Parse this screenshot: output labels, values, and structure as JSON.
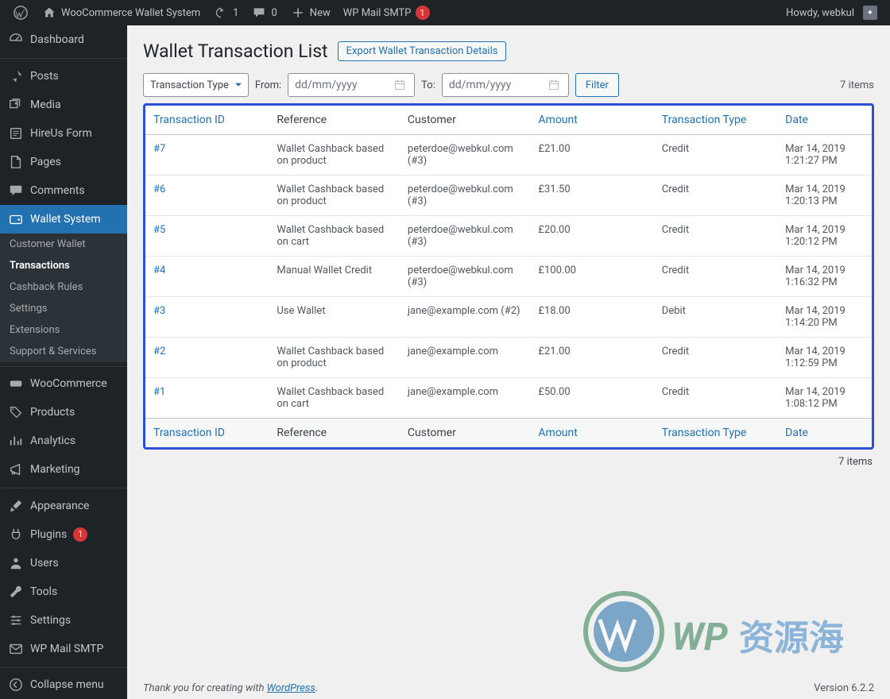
{
  "toolbar": {
    "site_name": "WooCommerce Wallet System",
    "updates": "1",
    "comments": "0",
    "new": "New",
    "smtp": "WP Mail SMTP",
    "smtp_badge": "1",
    "howdy": "Howdy, webkul"
  },
  "sidebar": {
    "items": [
      {
        "label": "Dashboard"
      },
      {
        "label": "Posts"
      },
      {
        "label": "Media"
      },
      {
        "label": "HireUs Form"
      },
      {
        "label": "Pages"
      },
      {
        "label": "Comments"
      },
      {
        "label": "Wallet System"
      },
      {
        "label": "WooCommerce"
      },
      {
        "label": "Products"
      },
      {
        "label": "Analytics"
      },
      {
        "label": "Marketing"
      },
      {
        "label": "Appearance"
      },
      {
        "label": "Plugins"
      },
      {
        "label": "Users"
      },
      {
        "label": "Tools"
      },
      {
        "label": "Settings"
      },
      {
        "label": "WP Mail SMTP"
      },
      {
        "label": "Collapse menu"
      }
    ],
    "submenu": [
      {
        "label": "Customer Wallet"
      },
      {
        "label": "Transactions"
      },
      {
        "label": "Cashback Rules"
      },
      {
        "label": "Settings"
      },
      {
        "label": "Extensions"
      },
      {
        "label": "Support & Services"
      }
    ],
    "plugins_badge": "1"
  },
  "page": {
    "title": "Wallet Transaction List",
    "export": "Export Wallet Transaction Details",
    "txn_type": "Transaction Type",
    "from": "From:",
    "to": "To:",
    "date_placeholder": "dd/mm/yyyy",
    "filter": "Filter",
    "items": "7 items"
  },
  "columns": {
    "id": "Transaction ID",
    "ref": "Reference",
    "cust": "Customer",
    "amt": "Amount",
    "type": "Transaction Type",
    "date": "Date"
  },
  "rows": [
    {
      "id": "#7",
      "ref": "Wallet Cashback based on product",
      "cust": "peterdoe@webkul.com (#3)",
      "amt": "£21.00",
      "type": "Credit",
      "date": "Mar 14, 2019 1:21:27 PM"
    },
    {
      "id": "#6",
      "ref": "Wallet Cashback based on product",
      "cust": "peterdoe@webkul.com (#3)",
      "amt": "£31.50",
      "type": "Credit",
      "date": "Mar 14, 2019 1:20:13 PM"
    },
    {
      "id": "#5",
      "ref": "Wallet Cashback based on cart",
      "cust": "peterdoe@webkul.com (#3)",
      "amt": "£20.00",
      "type": "Credit",
      "date": "Mar 14, 2019 1:20:12 PM"
    },
    {
      "id": "#4",
      "ref": "Manual Wallet Credit",
      "cust": "peterdoe@webkul.com (#3)",
      "amt": "£100.00",
      "type": "Credit",
      "date": "Mar 14, 2019 1:16:32 PM"
    },
    {
      "id": "#3",
      "ref": "Use Wallet",
      "cust": "jane@example.com (#2)",
      "amt": "£18.00",
      "type": "Debit",
      "date": "Mar 14, 2019 1:14:20 PM"
    },
    {
      "id": "#2",
      "ref": "Wallet Cashback based on product",
      "cust": "jane@example.com",
      "amt": "£21.00",
      "type": "Credit",
      "date": "Mar 14, 2019 1:12:59 PM"
    },
    {
      "id": "#1",
      "ref": "Wallet Cashback based on cart",
      "cust": "jane@example.com",
      "amt": "£50.00",
      "type": "Credit",
      "date": "Mar 14, 2019 1:08:12 PM"
    }
  ],
  "footer": {
    "thanks": "Thank you for creating with ",
    "wp": "WordPress",
    "dot": ".",
    "version": "Version 6.2.2"
  },
  "watermark": "WP资源海"
}
